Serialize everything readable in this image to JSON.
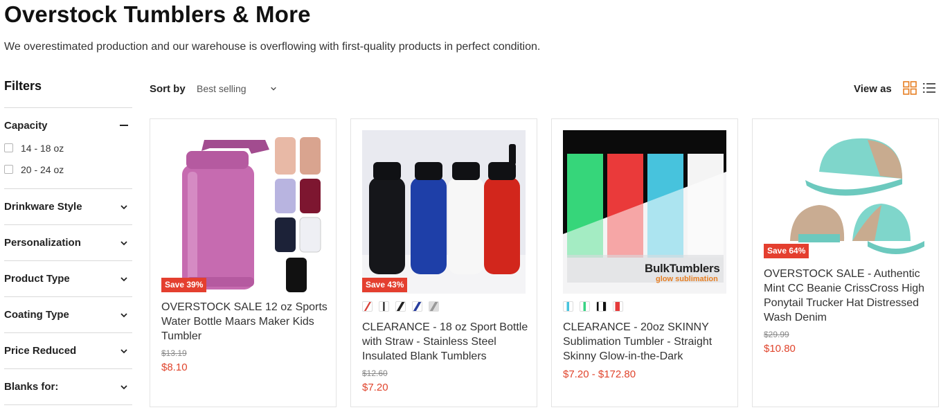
{
  "page": {
    "title": "Overstock Tumblers & More",
    "description": "We overestimated production and our warehouse is overflowing with first-quality products in perfect condition."
  },
  "filters": {
    "title": "Filters",
    "groups": [
      {
        "label": "Capacity",
        "expanded": true,
        "options": [
          "14 - 18 oz",
          "20 - 24 oz"
        ]
      },
      {
        "label": "Drinkware Style",
        "expanded": false
      },
      {
        "label": "Personalization",
        "expanded": false
      },
      {
        "label": "Product Type",
        "expanded": false
      },
      {
        "label": "Coating Type",
        "expanded": false
      },
      {
        "label": "Price Reduced",
        "expanded": false
      },
      {
        "label": "Blanks for:",
        "expanded": false
      }
    ]
  },
  "toolbar": {
    "sort_label": "Sort by",
    "sort_value": "Best selling",
    "view_label": "View as",
    "active_view": "grid"
  },
  "products": [
    {
      "title": "OVERSTOCK SALE 12 oz Sports Water Bottle Maars Maker Kids Tumbler",
      "badge": "Save 39%",
      "old_price": "$13.19",
      "price": "$8.10"
    },
    {
      "title": "CLEARANCE - 18 oz Sport Bottle with Straw - Stainless Steel Insulated Blank Tumblers",
      "badge": "Save 43%",
      "old_price": "$12.60",
      "price": "$7.20",
      "swatches": [
        "#d8443c",
        "#eaeaea",
        "#222222",
        "#2a3f9e",
        "#c4c4c4"
      ]
    },
    {
      "title": "CLEARANCE - 20oz SKINNY Sublimation Tumbler - Straight Skinny Glow-in-the-Dark",
      "price": "$7.20 - $172.80",
      "swatches": [
        "#47c3dd",
        "#38d383",
        "#ffffff",
        "#e53b3b"
      ],
      "image_brand": "BulkTumblers",
      "image_tagline": "glow sublimation"
    },
    {
      "title": "OVERSTOCK SALE - Authentic Mint CC Beanie CrissCross High Ponytail Trucker Hat Distressed Wash Denim",
      "badge": "Save 64%",
      "old_price": "$29.99",
      "price": "$10.80"
    }
  ],
  "colors": {
    "accent": "#e0442c",
    "badge": "#e43f2f",
    "view_icon_active": "#e67e22"
  }
}
